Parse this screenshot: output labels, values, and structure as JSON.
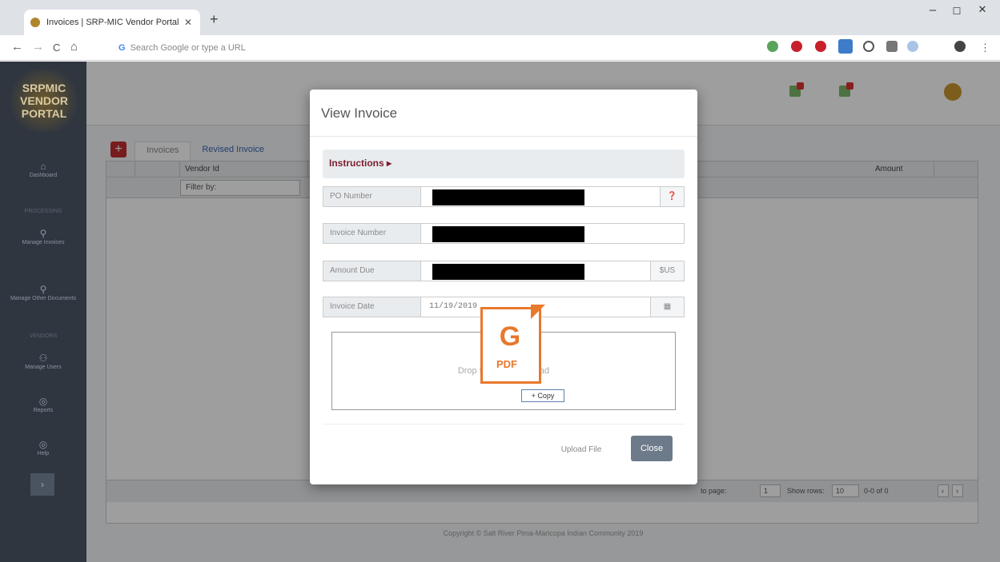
{
  "browser": {
    "tab_title": "Invoices | SRP-MIC Vendor Portal",
    "close_tab": "✕",
    "new_tab": "+",
    "minimize": "–",
    "maximize": "☐",
    "close": "✕",
    "back": "←",
    "forward": "→",
    "reload": "C",
    "home": "⌂",
    "omnibox_prefix": "G",
    "omnibox_placeholder": "Search Google or type a URL",
    "menu": "⋮"
  },
  "sidebar": {
    "logo_lines": [
      "SRPMIC",
      "VENDOR",
      "PORTAL"
    ],
    "items": [
      {
        "label": "Dashboard",
        "icon": "home-icon"
      },
      {
        "label": "PROCESSING",
        "heading": true
      },
      {
        "label": "Manage Invoices",
        "icon": "invoice-icon"
      },
      {
        "label": "Manage Other Documents",
        "icon": "documents-icon"
      },
      {
        "label": "VENDORS",
        "heading": true
      },
      {
        "label": "Manage Users",
        "icon": "users-icon"
      },
      {
        "label": "Reports",
        "icon": "reports-icon"
      },
      {
        "label": "Help",
        "icon": "help-icon"
      }
    ],
    "collapse": "›"
  },
  "main": {
    "add_button": "+",
    "tabs": [
      {
        "label": "Invoices",
        "active": true
      },
      {
        "label": "Revised Invoice",
        "active": false
      }
    ],
    "grid": {
      "columns": [
        "Vendor Id",
        "Amount"
      ],
      "filter_placeholder": "Filter by:"
    },
    "pagination": {
      "goto_label": "to page:",
      "goto_value": "1",
      "show_rows_label": "Show rows:",
      "rows_value": "10",
      "range": "0-0 of 0",
      "prev": "‹",
      "next": "›"
    },
    "copyright": "Copyright © Salt River Pima-Maricopa Indian Community 2019"
  },
  "modal": {
    "title": "View Invoice",
    "instructions": "Instructions ▸",
    "fields": [
      {
        "label": "PO Number",
        "value": "",
        "suffix_icon": "help-icon"
      },
      {
        "label": "Invoice Number",
        "value": ""
      },
      {
        "label": "Amount Due",
        "value": "",
        "suffix": "$US"
      },
      {
        "label": "Invoice Date",
        "value": "11/19/2019",
        "suffix_icon": "calendar-icon"
      }
    ],
    "dropzone_text": "Drop file here to upload",
    "upload_label": "Upload File",
    "close_label": "Close"
  },
  "drag": {
    "pdf_label": "PDF",
    "copy_label": "+ Copy"
  },
  "colors": {
    "sidebar_bg": "#2f3640",
    "instructions_text": "#7b1d2e",
    "drag_accent": "#e8782d",
    "close_button": "#6c7a89"
  }
}
